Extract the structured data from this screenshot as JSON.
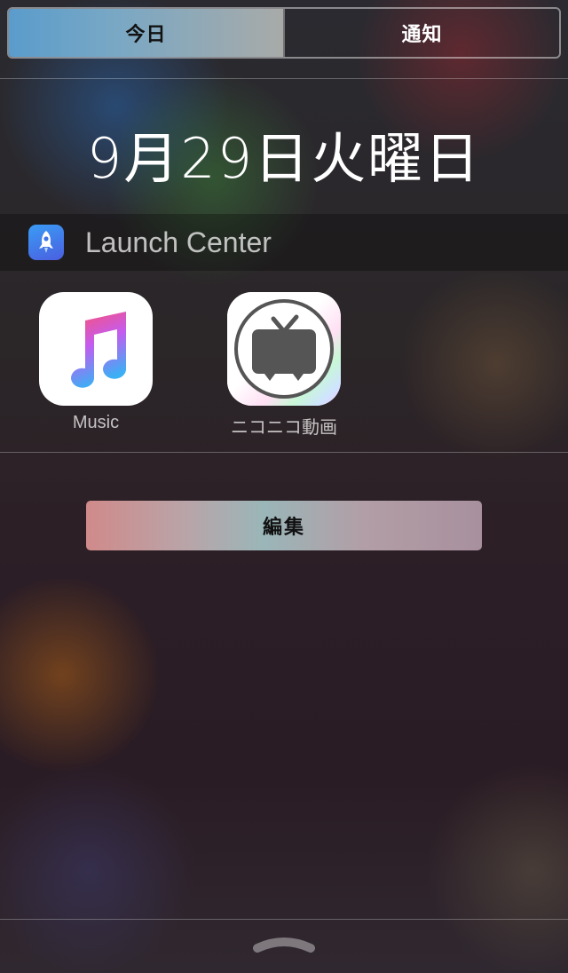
{
  "tabs": [
    {
      "label": "今日",
      "active": true
    },
    {
      "label": "通知",
      "active": false
    }
  ],
  "date": "9月29日火曜日",
  "widget": {
    "title": "Launch Center",
    "icon": "rocket-icon",
    "shortcuts": [
      {
        "label": "Music",
        "icon": "music-note-icon"
      },
      {
        "label": "ニコニコ動画",
        "icon": "tv-icon"
      }
    ]
  },
  "edit_label": "編集",
  "grabber_icon": "chevron-up-icon",
  "colors": {
    "accent_tab": "#5a9ccc",
    "launch_icon": "#3a9cf5"
  }
}
